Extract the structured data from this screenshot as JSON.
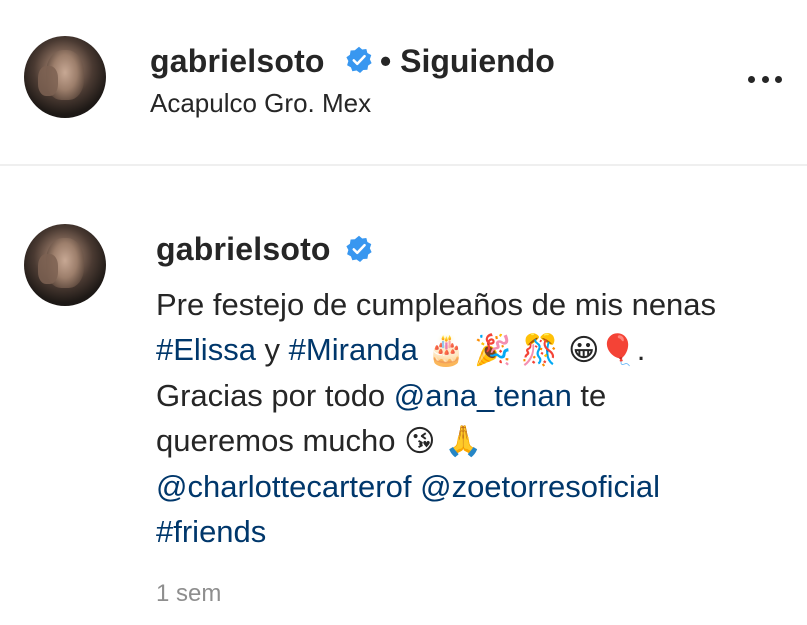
{
  "header": {
    "username": "gabrielsoto",
    "separator": "•",
    "follow_status": "Siguiendo",
    "location": "Acapulco Gro. Mex",
    "more_icon": "more-horizontal-icon"
  },
  "post": {
    "username": "gabrielsoto",
    "caption": {
      "line1": "Pre festejo de cumpleaños de mis nenas",
      "line2": {
        "hashtag1": "#Elissa",
        "word_and": " y ",
        "hashtag2": "#Miranda",
        "emojis": " 🎂 🎉 🎊 😀🎈",
        "period": "."
      },
      "line3": {
        "text": "Gracias por todo ",
        "mention": "@ana_tenan",
        "tail": " te"
      },
      "line4": {
        "text": "queremos mucho ",
        "emojis": "😘 🙏"
      },
      "line5": {
        "mention1": "@charlottecarterof",
        "space": " ",
        "mention2": "@zoetorresoficial"
      },
      "line6": {
        "hashtag": "#friends"
      }
    },
    "timestamp": "1 sem"
  },
  "colors": {
    "text": "#262626",
    "link": "#00376b",
    "muted": "#8e8e8e",
    "verified": "#3897f0",
    "divider": "#efefef"
  }
}
